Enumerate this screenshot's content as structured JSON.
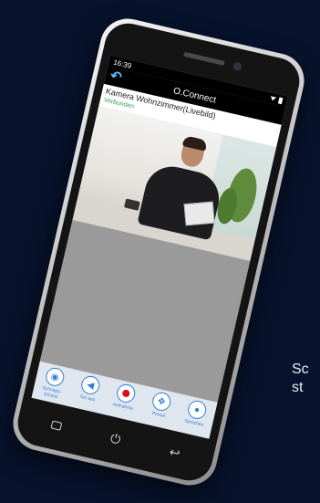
{
  "status_bar": {
    "time": "16:39"
  },
  "app_bar": {
    "title": "O.Connect",
    "back_icon": "back-arrow-icon"
  },
  "camera": {
    "name": "Kamera Wohnzimmer(Livebild)",
    "status": "Verbunden",
    "status_color": "#3aa14a"
  },
  "toolbar": {
    "buttons": [
      {
        "label": "Schnapp-\nschuss",
        "icon": "camera-lens-icon"
      },
      {
        "label": "Ton aus",
        "icon": "speaker-mute-icon"
      },
      {
        "label": "Aufnahme",
        "icon": "record-icon"
      },
      {
        "label": "Preset",
        "icon": "pan-tilt-icon"
      },
      {
        "label": "Sprechen",
        "icon": "microphone-icon"
      }
    ],
    "accent": "#2f7fd6",
    "record_color": "#d8101f"
  },
  "side_text": {
    "line1": "Sc",
    "line2": "st"
  }
}
